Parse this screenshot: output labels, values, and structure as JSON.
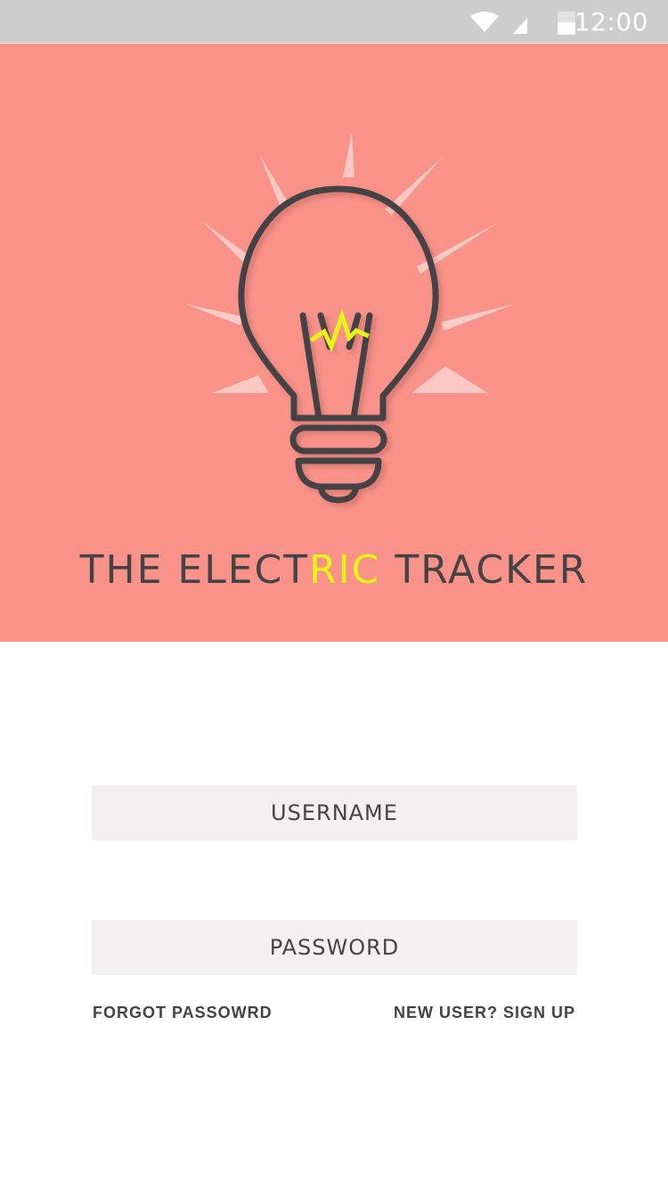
{
  "status_bar": {
    "time": "12:00",
    "icons": [
      "wifi-icon",
      "signal-icon",
      "battery-icon"
    ],
    "background": "#cdcdcd"
  },
  "hero": {
    "background": "#f9938a",
    "logo_icon": "lightbulb-icon",
    "title_part1": "THE ELECT",
    "title_highlight": "RIC",
    "title_part2": " TRACKER",
    "highlight_color": "#e8f417"
  },
  "login": {
    "username_placeholder": "USERNAME",
    "password_placeholder": "PASSWORD",
    "forgot_password_label": "FORGOT PASSOWRD",
    "signup_label": "NEW USER? SIGN UP"
  },
  "colors": {
    "text_dark": "#454345",
    "field_bg": "#f2f0f1"
  }
}
